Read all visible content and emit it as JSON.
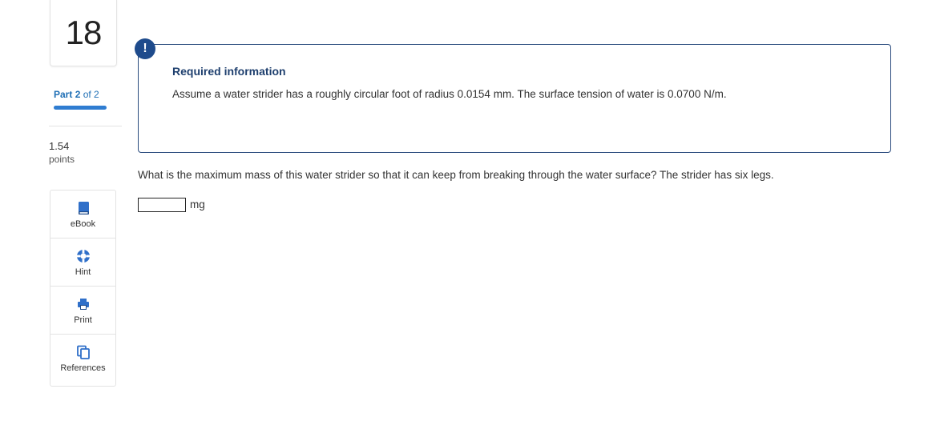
{
  "sidebar": {
    "question_number": "18",
    "part_word": "Part",
    "part_current": "2",
    "part_of": "of 2",
    "progress": 1.0,
    "points_value": "1.54",
    "points_label": "points",
    "tools": [
      {
        "label": "eBook",
        "icon": "book-icon"
      },
      {
        "label": "Hint",
        "icon": "lifebuoy-icon"
      },
      {
        "label": "Print",
        "icon": "printer-icon"
      },
      {
        "label": "References",
        "icon": "copy-icon"
      }
    ]
  },
  "info": {
    "badge": "!",
    "title": "Required information",
    "text": "Assume a water strider has a roughly circular foot of radius 0.0154 mm. The surface tension of water is 0.0700 N/m."
  },
  "question": {
    "text": "What is the maximum mass of this water strider so that it can keep from breaking through the water surface? The strider has six legs.",
    "answer_value": "",
    "unit": "mg"
  },
  "colors": {
    "accent": "#2f7dd1",
    "info_border": "#2b4c7e",
    "badge_bg": "#1e4b8c",
    "icon_blue": "#2f6fc9"
  }
}
